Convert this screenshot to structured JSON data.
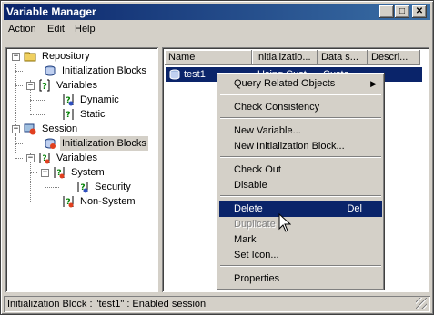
{
  "window": {
    "title": "Variable Manager",
    "minimize": "_",
    "maximize": "□",
    "close": "✕"
  },
  "menu": [
    "Action",
    "Edit",
    "Help"
  ],
  "tree": {
    "repository": "Repository",
    "repo_init_blocks": "Initialization Blocks",
    "repo_variables": "Variables",
    "dynamic": "Dynamic",
    "static": "Static",
    "session": "Session",
    "session_init_blocks": "Initialization Blocks",
    "session_variables": "Variables",
    "system": "System",
    "security": "Security",
    "non_system": "Non-System"
  },
  "list": {
    "columns": [
      "Name",
      "Initializatio...",
      "Data s...",
      "Descri..."
    ],
    "row": [
      "test1",
      "Using Cust...",
      "Custo...",
      ""
    ]
  },
  "context_menu": {
    "query": "Query Related Objects",
    "check_consistency": "Check Consistency",
    "new_variable": "New Variable...",
    "new_init_block": "New Initialization Block...",
    "check_out": "Check Out",
    "disable": "Disable",
    "delete": "Delete",
    "delete_shortcut": "Del",
    "duplicate": "Duplicate",
    "mark": "Mark",
    "set_icon": "Set Icon...",
    "properties": "Properties"
  },
  "status": "Initialization Block : \"test1\" : Enabled session",
  "colors": {
    "titlebar": "#0a246a",
    "highlight": "#0a246a",
    "face": "#d4d0c8"
  }
}
